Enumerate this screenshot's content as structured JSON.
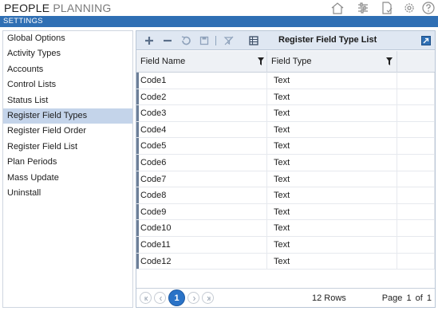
{
  "app": {
    "title_part1": "PEOPLE",
    "title_part2": "PLANNING",
    "section": "SETTINGS"
  },
  "top_icons": [
    "home-icon",
    "sliders-icon",
    "document-check-icon",
    "settings-icon",
    "help-icon"
  ],
  "sidebar": {
    "items": [
      {
        "label": "Global Options"
      },
      {
        "label": "Activity Types"
      },
      {
        "label": "Accounts"
      },
      {
        "label": "Control Lists"
      },
      {
        "label": "Status List"
      },
      {
        "label": "Register Field Types",
        "active": true
      },
      {
        "label": "Register Field Order"
      },
      {
        "label": "Register Field List"
      },
      {
        "label": "Plan Periods"
      },
      {
        "label": "Mass Update"
      },
      {
        "label": "Uninstall"
      }
    ]
  },
  "panel": {
    "title": "Register Field Type List",
    "toolbar_icons": [
      "add-icon",
      "remove-icon",
      "undo-icon",
      "save-icon",
      "clear-filter-icon",
      "export-icon",
      "expand-icon"
    ]
  },
  "grid": {
    "columns": [
      "Field Name",
      "Field Type"
    ],
    "rows": [
      {
        "name": "Code1",
        "type": "Text"
      },
      {
        "name": "Code2",
        "type": "Text"
      },
      {
        "name": "Code3",
        "type": "Text"
      },
      {
        "name": "Code4",
        "type": "Text"
      },
      {
        "name": "Code5",
        "type": "Text"
      },
      {
        "name": "Code6",
        "type": "Text"
      },
      {
        "name": "Code7",
        "type": "Text"
      },
      {
        "name": "Code8",
        "type": "Text"
      },
      {
        "name": "Code9",
        "type": "Text"
      },
      {
        "name": "Code10",
        "type": "Text"
      },
      {
        "name": "Code11",
        "type": "Text"
      },
      {
        "name": "Code12",
        "type": "Text"
      }
    ]
  },
  "footer": {
    "current_page": "1",
    "rows_text": "12 Rows",
    "page_label": "Page",
    "page_number": "1",
    "of_label": "of 1"
  },
  "colors": {
    "accent": "#2f6fb4",
    "active_item": "#c4d4ea",
    "toolbar": "#dfe7f2"
  }
}
